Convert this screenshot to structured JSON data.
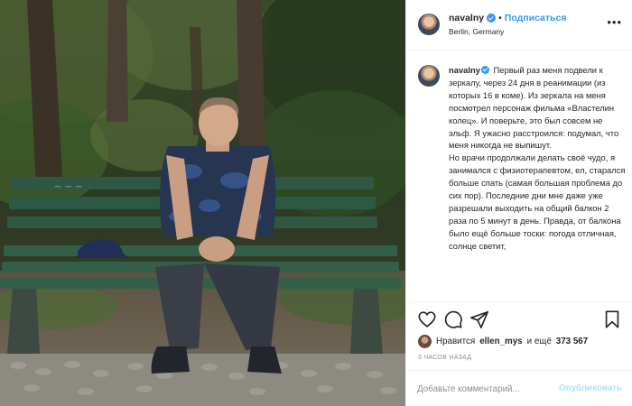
{
  "post": {
    "username": "navalny",
    "follow_separator": "•",
    "follow_label": "Подписаться",
    "location": "Berlin, Germany",
    "more_icon": "more-horizontal-icon"
  },
  "caption": {
    "username": "navalny",
    "lines": [
      "Первый раз меня подвели к зеркалу, через 24 дня в реанимации (из которых 16 в коме). Из зеркала на меня посмотрел персонаж фильма «Властелин колец». И поверьте, это был совсем не эльф. Я ужасно расстроился: подумал, что меня никогда не выпишут.",
      "Но врачи продолжали делать своё чудо, я занимался с физиотерапевтом, ел, старался больше спать (самая большая проблема до сих пор). Последние дни мне даже уже разрешали выходить на общий балкон 2 раза по 5 минут в день. Правда, от балкона было ещё больше тоски: погода отличная, солнце светит,"
    ]
  },
  "actions": {
    "like_icon": "heart-icon",
    "comment_icon": "comment-icon",
    "share_icon": "send-icon",
    "save_icon": "bookmark-icon"
  },
  "likes": {
    "prefix": "Нравится",
    "liker": "ellen_mys",
    "connector": "и ещё",
    "count": "373 567"
  },
  "timestamp": "3 ЧАСОВ НАЗАД",
  "comment": {
    "placeholder": "Добавьте комментарий...",
    "publish_label": "Опубликовать"
  },
  "colors": {
    "link_blue": "#3897f0",
    "publish_disabled": "#b2dffc",
    "meta_gray": "#8e8e8e",
    "text": "#262626"
  }
}
